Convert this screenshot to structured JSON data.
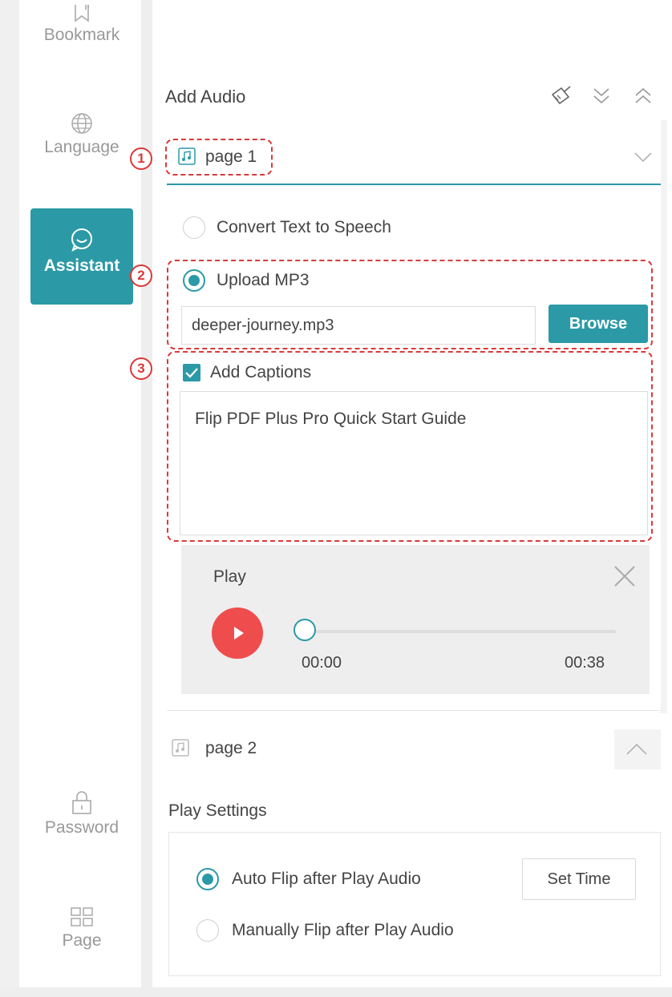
{
  "sidebar": {
    "items": [
      {
        "label": "Bookmark",
        "icon": "bookmark-icon"
      },
      {
        "label": "Language",
        "icon": "globe-icon"
      },
      {
        "label": "Assistant",
        "icon": "chat-icon",
        "active": true
      },
      {
        "label": "Password",
        "icon": "lock-icon"
      },
      {
        "label": "Page",
        "icon": "grid-icon"
      }
    ]
  },
  "panel": {
    "title": "Add Audio",
    "page1": {
      "label": "page 1",
      "options": {
        "tts_label": "Convert Text to Speech",
        "mp3_label": "Upload MP3",
        "selected": "mp3"
      },
      "file_value": "deeper-journey.mp3",
      "browse_label": "Browse",
      "captions_label": "Add Captions",
      "captions_checked": true,
      "captions_text": "Flip PDF Plus Pro Quick Start Guide",
      "player": {
        "title": "Play",
        "current_time": "00:00",
        "total_time": "00:38",
        "progress": 0
      }
    },
    "page2": {
      "label": "page 2"
    },
    "play_settings": {
      "title": "Play Settings",
      "auto_label": "Auto Flip after Play Audio",
      "manual_label": "Manually Flip after Play Audio",
      "selected": "auto",
      "set_time_label": "Set Time"
    }
  },
  "callouts": [
    "1",
    "2",
    "3"
  ],
  "colors": {
    "accent": "#2b9aa6",
    "annotation": "#d93a3a",
    "play_button": "#ef4d4d"
  }
}
